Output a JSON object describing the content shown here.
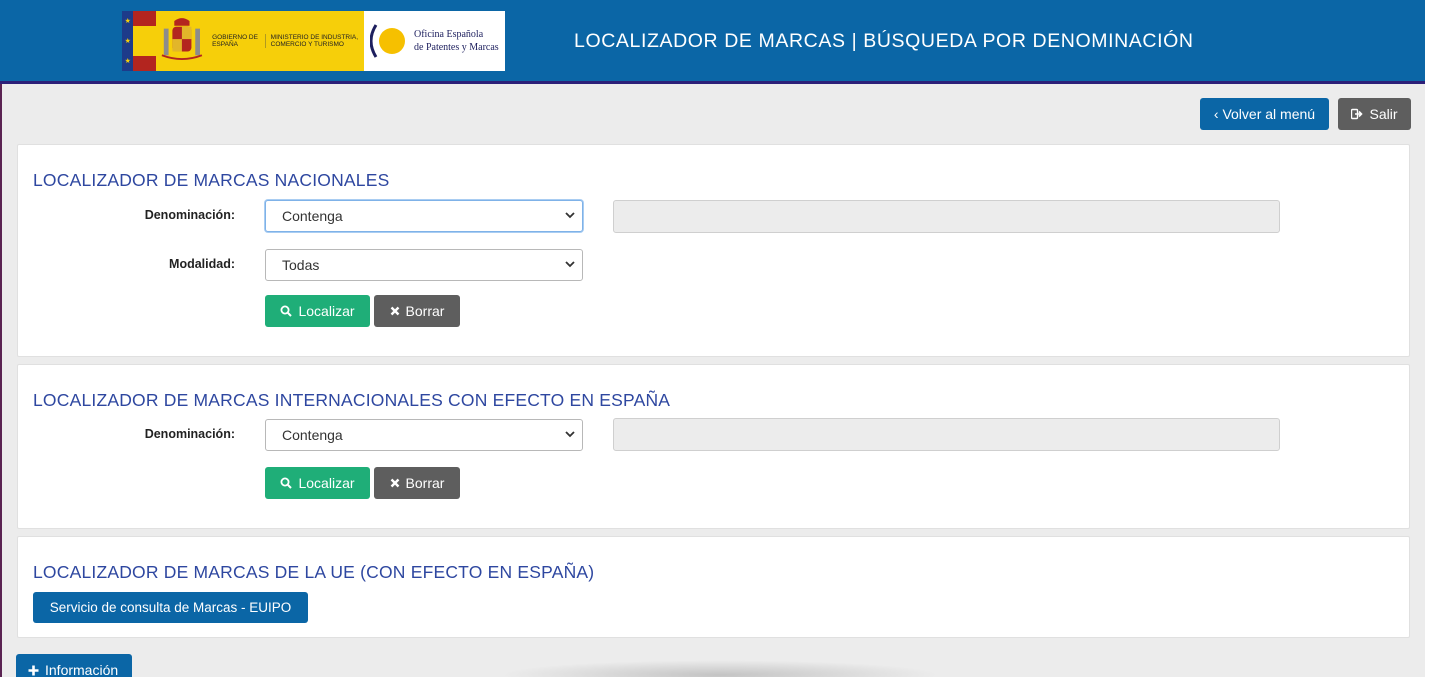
{
  "header": {
    "gov_text": "Gobierno de España",
    "ministry_text": "Ministerio de Industria, Comercio y Turismo",
    "oepm_line1": "Oficina Española",
    "oepm_line2": "de Patentes y Marcas",
    "title": "LOCALIZADOR DE MARCAS | BÚSQUEDA POR DENOMINACIÓN"
  },
  "toolbar": {
    "back_label": "‹ Volver al menú",
    "exit_label": "Salir"
  },
  "national": {
    "title": "LOCALIZADOR DE MARCAS NACIONALES",
    "denominacion_label": "Denominación:",
    "denominacion_value": "Contenga",
    "modalidad_label": "Modalidad:",
    "modalidad_value": "Todas",
    "search_label": "Localizar",
    "clear_label": "Borrar"
  },
  "international": {
    "title": "LOCALIZADOR DE MARCAS INTERNACIONALES CON EFECTO EN ESPAÑA",
    "denominacion_label": "Denominación:",
    "denominacion_value": "Contenga",
    "search_label": "Localizar",
    "clear_label": "Borrar"
  },
  "eu": {
    "title": "LOCALIZADOR DE MARCAS DE LA UE (CON EFECTO EN ESPAÑA)",
    "service_label": "Servicio de consulta de Marcas - EUIPO"
  },
  "info": {
    "label": "Información"
  },
  "colors": {
    "header_bg": "#0b66a6",
    "title_blue": "#2e47a0",
    "button_green": "#1fae78",
    "button_gray": "#5e5e5e"
  },
  "icons": [
    "search-icon",
    "close-icon",
    "exit-icon",
    "plus-icon",
    "chevron-down-icon"
  ]
}
